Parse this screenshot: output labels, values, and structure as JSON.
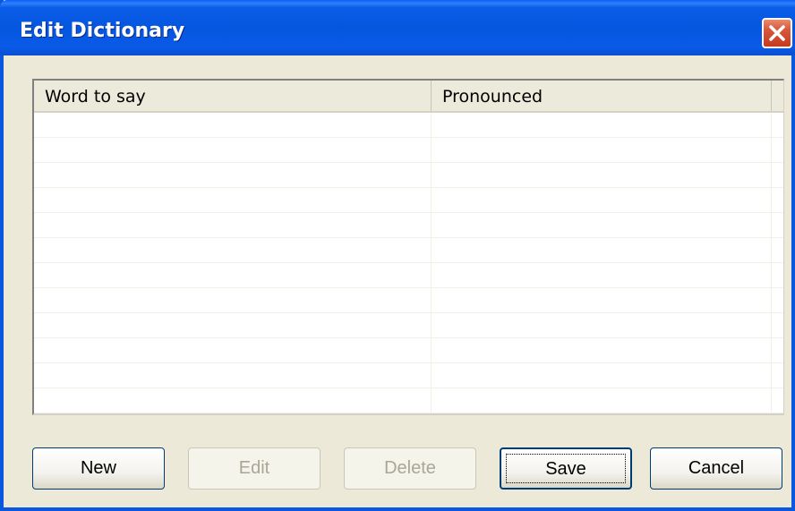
{
  "window": {
    "title": "Edit Dictionary"
  },
  "list": {
    "columns": [
      "Word to say",
      "Pronounced"
    ],
    "rows": []
  },
  "buttons": {
    "new_label": "New",
    "edit_label": "Edit",
    "delete_label": "Delete",
    "save_label": "Save",
    "cancel_label": "Cancel"
  },
  "icons": {
    "close": "close-icon"
  },
  "colors": {
    "titlebar": "#0556DF",
    "close_button": "#D8553A",
    "dialog_background": "#ECE9D8"
  }
}
